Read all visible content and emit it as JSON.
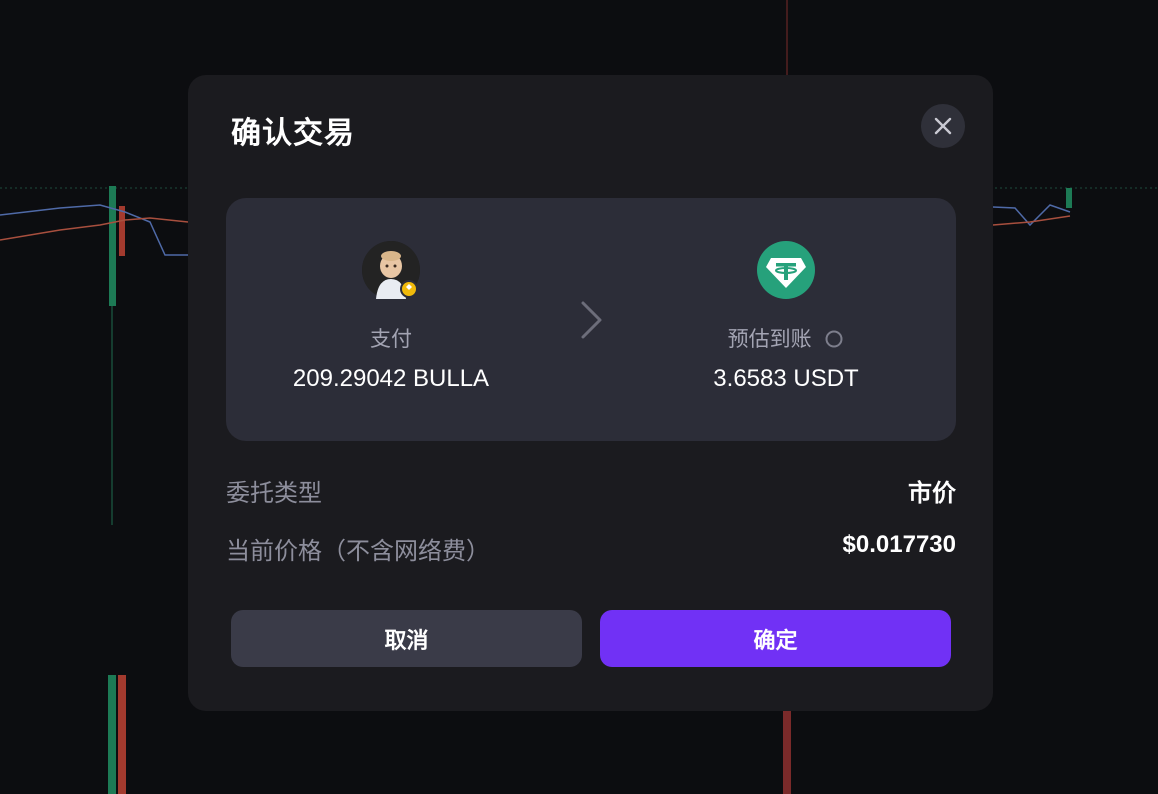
{
  "dialog": {
    "title": "确认交易"
  },
  "swap": {
    "pay": {
      "label": "支付",
      "amount": "209.29042 BULLA",
      "token_icon": "bulla-token-avatar"
    },
    "receive": {
      "label": "预估到账",
      "amount": "3.6583 USDT",
      "token_icon": "usdt-tether-icon",
      "token_color": "#26a17b"
    }
  },
  "details": {
    "order_type_label": "委托类型",
    "order_type_value": "市价",
    "price_label": "当前价格（不含网络费）",
    "price_value": "$0.017730"
  },
  "actions": {
    "cancel_label": "取消",
    "confirm_label": "确定",
    "confirm_color": "#7131f5"
  }
}
